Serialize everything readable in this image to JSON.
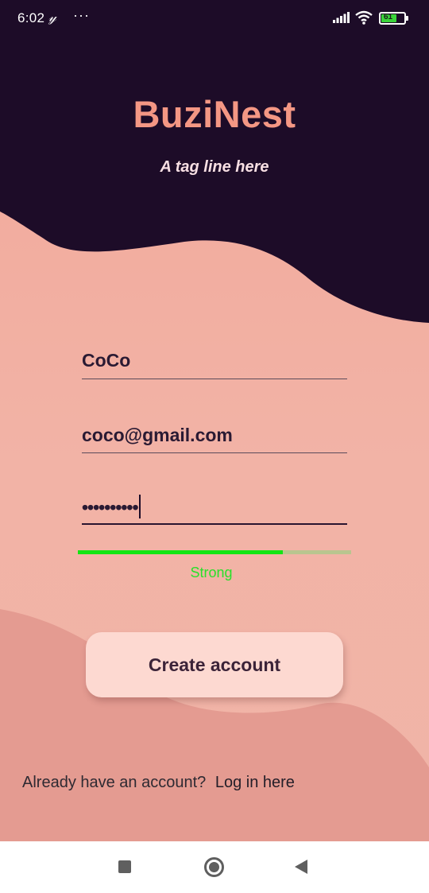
{
  "status_bar": {
    "time": "6:02",
    "carrier_glyph": "𝓎",
    "more_dots": "···",
    "battery_level": "61",
    "icons": [
      "signal-icon",
      "wifi-icon",
      "battery-icon"
    ]
  },
  "header": {
    "app_name": "BuziNest",
    "tagline": "A tag line here"
  },
  "form": {
    "name_value": "CoCo",
    "email_value": "coco@gmail.com",
    "password_mask": "••••••••••",
    "password_strength": {
      "label": "Strong",
      "fraction": 0.75
    },
    "submit_label": "Create account"
  },
  "footer": {
    "prompt": "Already have an account?",
    "login_link": "Log in here"
  },
  "nav_bar": {
    "icons": [
      "recents-icon",
      "home-icon",
      "back-icon"
    ]
  },
  "colors": {
    "header_dark": "#1d0c28",
    "brand": "#f49784",
    "background": "#f3a799",
    "lower_wave": "#e49b91",
    "button": "#fdd9d1",
    "strength_fill": "#14e514",
    "strength_track": "#b9c58f"
  }
}
